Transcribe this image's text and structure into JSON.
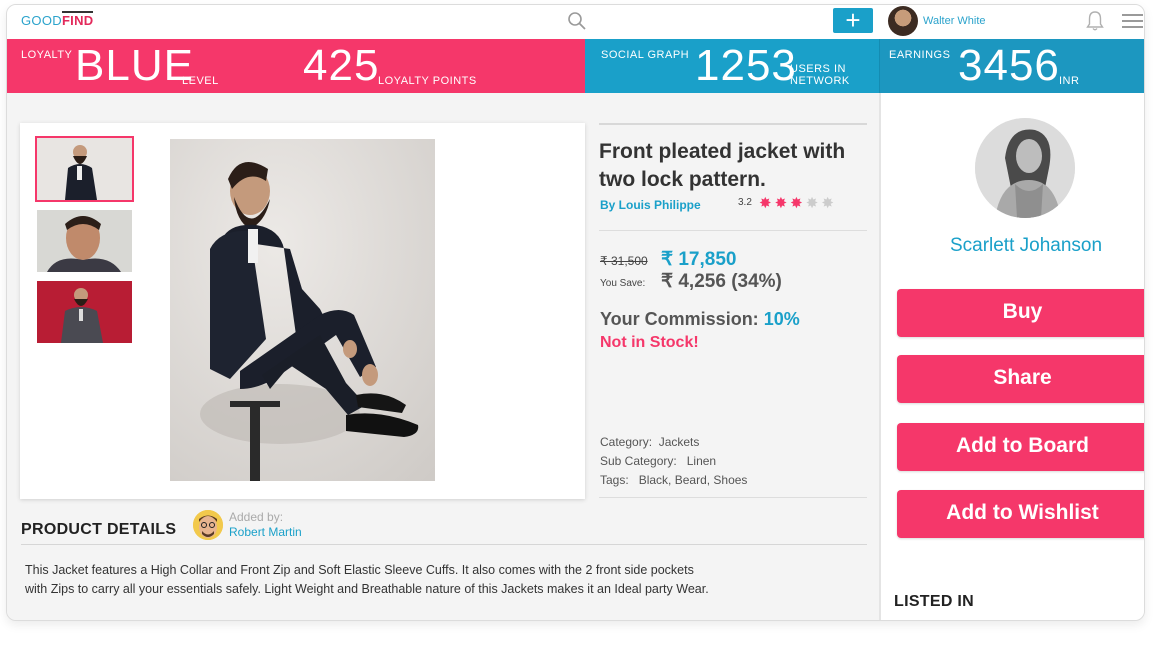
{
  "app": {
    "logo_good": "GOOD",
    "logo_find": "FIND"
  },
  "topbar": {
    "search_icon": "search-icon",
    "add_label": "+",
    "user_name": "Walter White",
    "bell_icon": "bell-icon",
    "menu_icon": "hamburger-menu-icon"
  },
  "stats": {
    "loyalty_label": "LOYALTY",
    "loyalty_level": "BLUE",
    "level_label": "LEVEL",
    "points_value": "425",
    "points_label": "LOYALTY POINTS",
    "social_label": "SOCIAL GRAPH",
    "users_value": "1253",
    "users_label_1": "USERS IN",
    "users_label_2": "NETWORK",
    "earnings_label": "EARNINGS",
    "earnings_value": "3456",
    "earnings_unit": "INR"
  },
  "product": {
    "title_line1": "Front pleated jacket with",
    "title_line2": "two lock pattern.",
    "brand": "By Louis Philippe",
    "rating_text": "3.2",
    "rating_value": 3.2,
    "rating_max": 5,
    "old_price": "₹ 31,500 ",
    "new_price": "₹ 17,850",
    "you_save_label": "You Save:",
    "save_value": "₹ 4,256 (34%)",
    "commission_label": "Your Commission: ",
    "commission_value": "10%",
    "stock_status": "Not in Stock!",
    "category_label": "Category:",
    "category_value": "Jackets",
    "subcategory_label": "Sub Category:",
    "subcategory_value": "Linen",
    "tags_label": "Tags:",
    "tags_value": "Black, Beard, Shoes"
  },
  "details": {
    "heading": "PRODUCT DETAILS",
    "added_by_label": "Added by:",
    "added_by_name": "Robert Martin",
    "description": "This Jacket features a High Collar and Front Zip and Soft Elastic Sleeve Cuffs. It also comes with the 2 front side pockets with Zips to carry all your essentials safely. Light Weight and Breathable nature of this Jackets makes it an Ideal party Wear."
  },
  "sidebar": {
    "seller_name": "Scarlett Johanson",
    "buy_label": "Buy",
    "share_label": "Share",
    "board_label": "Add to Board",
    "wishlist_label": "Add to Wishlist",
    "listed_in_label": "LISTED IN"
  },
  "colors": {
    "accent_pink": "#f5376a",
    "accent_blue": "#1aa0c9"
  }
}
